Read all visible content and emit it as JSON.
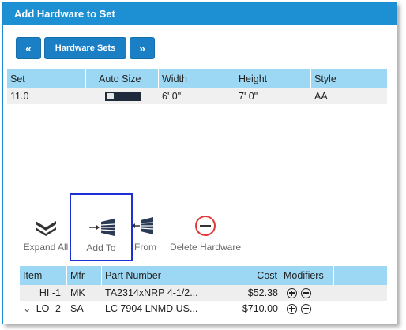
{
  "dialog": {
    "title": "Add Hardware to Set"
  },
  "nav": {
    "prev_icon": "«",
    "sets_label": "Hardware Sets",
    "next_icon": "»"
  },
  "set_table": {
    "headers": [
      "Set",
      "Auto Size",
      "Width",
      "Height",
      "Style"
    ],
    "rows": [
      {
        "set": "11.0",
        "width": "6' 0\"",
        "height": "7' 0\"",
        "style": "AA"
      }
    ]
  },
  "toolbar": {
    "expand_all": "Expand All",
    "add_to": "Add To",
    "from": "From",
    "delete_hardware": "Delete Hardware"
  },
  "hardware_table": {
    "headers": [
      "Item",
      "Mfr",
      "Part Number",
      "Cost",
      "Modifiers"
    ],
    "rows": [
      {
        "item": "HI -1",
        "mfr": "MK",
        "part": "TA2314xNRP 4-1/2...",
        "cost": "$52.38"
      },
      {
        "item": "LO -2",
        "mfr": "SA",
        "part": "LC 7904 LNMD US...",
        "cost": "$710.00"
      }
    ],
    "row2_expander": "⌄"
  },
  "colors": {
    "title_bar": "#1d8fd3",
    "nav_button": "#1b7fc6",
    "grid_header": "#9cd8f4",
    "selection_border": "#1f2fd6",
    "delete_icon": "#e03a3a"
  }
}
